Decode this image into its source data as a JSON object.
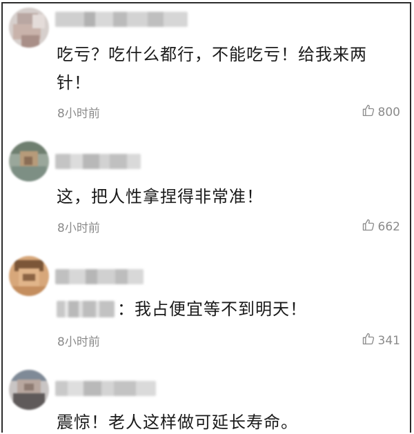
{
  "comments": [
    {
      "text": "吃亏？吃什么都行，不能吃亏！给我来两针！",
      "time": "8小时前",
      "likes": "800"
    },
    {
      "text": "这，把人性拿捏得非常准！",
      "time": "8小时前",
      "likes": "662"
    },
    {
      "text": "：我占便宜等不到明天！",
      "time": "8小时前",
      "likes": "341"
    },
    {
      "text": "震惊！老人这样做可延长寿命。"
    }
  ],
  "icons": {
    "like": "thumbs-up-outline-icon"
  },
  "colors": {
    "text": "#1a1a1a",
    "meta": "#8a8a8a",
    "border": "#2b2b2b"
  }
}
